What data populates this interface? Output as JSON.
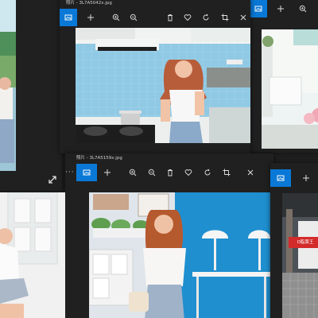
{
  "windows": {
    "top": {
      "title": "照片 - 3L7A5042x.jpg"
    },
    "bottom": {
      "title": "照片 - 3L7A5159x.jpg"
    }
  },
  "misc": {
    "more": "···"
  },
  "sign_text": "O脂黄王",
  "icons": {
    "toolbar": [
      "image-icon",
      "add-icon",
      "zoom-in-icon",
      "zoom-out-icon",
      "delete-icon",
      "favorite-icon",
      "rotate-icon",
      "crop-icon",
      "edit-icon"
    ]
  },
  "colors": {
    "accent": "#0a78d6",
    "window_bg": "#202020",
    "tile_blue": "#8fc9e4",
    "wall_blue": "#1f8fd0"
  }
}
